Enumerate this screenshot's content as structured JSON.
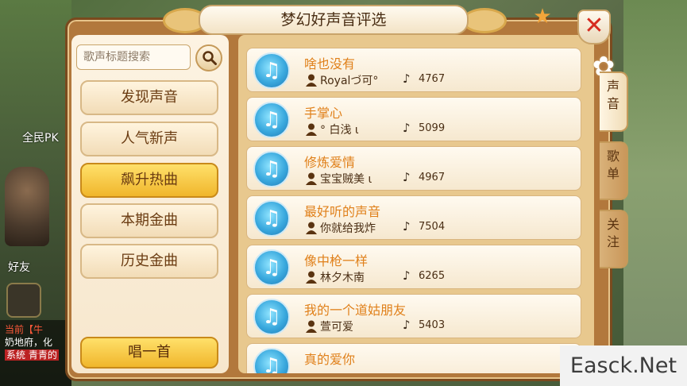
{
  "window": {
    "title": "梦幻好声音评选"
  },
  "background": {
    "tag_label": "全民PK",
    "friend_label": "好友",
    "chat_lines": [
      "当前【牛",
      "奶地府，化",
      "系统 青青的"
    ]
  },
  "search": {
    "placeholder": "歌声标题搜索"
  },
  "menu": {
    "items": [
      {
        "label": "发现声音",
        "active": false
      },
      {
        "label": "人气新声",
        "active": false
      },
      {
        "label": "飙升热曲",
        "active": true
      },
      {
        "label": "本期金曲",
        "active": false
      },
      {
        "label": "历史金曲",
        "active": false
      }
    ],
    "sing_label": "唱一首"
  },
  "songs": [
    {
      "title": "啥也没有",
      "singer": "Royalづ可°",
      "count": "4767"
    },
    {
      "title": "手掌心",
      "singer": "° 白浅 ι",
      "count": "5099"
    },
    {
      "title": "修炼爱情",
      "singer": "宝宝贼美 ι",
      "count": "4967"
    },
    {
      "title": "最好听的声音",
      "singer": "你就给我炸",
      "count": "7504"
    },
    {
      "title": "像中枪一样",
      "singer": "林夕木南",
      "count": "6265"
    },
    {
      "title": "我的一个道姑朋友",
      "singer": "萱可爱",
      "count": "5403"
    },
    {
      "title": "真的爱你",
      "singer": "",
      "count": ""
    }
  ],
  "tabs": [
    {
      "label": "声音",
      "active": true
    },
    {
      "label": "歌单",
      "active": false
    },
    {
      "label": "关注",
      "active": false
    }
  ],
  "colors": {
    "accent_gold": "#f0b62c",
    "title_text": "#e0801a",
    "panel_brown": "#b2783c",
    "close_red": "#d62b1f"
  },
  "icons": {
    "close": "close-icon",
    "search": "search-icon",
    "disc": "music-note-icon",
    "user": "user-icon",
    "plays": "note-icon",
    "star": "star-icon",
    "flower": "flower-icon"
  },
  "watermark": "Easck.Net"
}
